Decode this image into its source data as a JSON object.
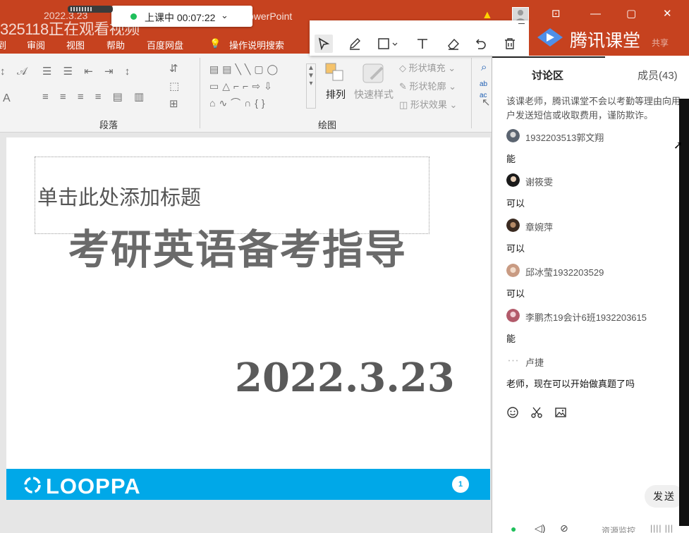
{
  "ppt": {
    "watermark": "325118正在观看视频",
    "date_stamp": "2022.3.23",
    "app_title": "owerPoint",
    "window_controls": [
      "⊡",
      "—",
      "▢",
      "✕"
    ],
    "menu": [
      "到",
      "审阅",
      "视图",
      "帮助",
      "百度网盘",
      "操作说明搜索"
    ],
    "ribbon": {
      "group_paragraph": "段落",
      "group_drawing": "绘图",
      "arrange_label": "排列",
      "quick_styles_label": "快速样式",
      "shape_fill": "形状填充",
      "shape_outline": "形状轮廓",
      "shape_effect": "形状效果",
      "font_a": "A"
    }
  },
  "recording": {
    "status_text": "上课中 00:07:22",
    "status_color": "#1fbf5b"
  },
  "draw_toolbar": {
    "tools": [
      "pointer-icon",
      "pen-icon",
      "rectangle-icon",
      "text-icon",
      "eraser-icon",
      "undo-icon",
      "delete-icon"
    ]
  },
  "slide": {
    "placeholder": "单击此处添加标题",
    "title": "考研英语备考指导",
    "date": "2022.3.23",
    "logo": "LOOPPA",
    "page_number": "1",
    "footer_color": "#00a8e8"
  },
  "tencent": {
    "app_name": "腾讯课堂",
    "share_label": "共享",
    "tabs": {
      "discussion": "讨论区",
      "members": "成员(43)"
    },
    "notice": "该课老师，腾讯课堂不会以考勤等理由向用户发送短信或收取费用，谨防欺诈。",
    "messages": [
      {
        "user": "1932203513郭文翔",
        "text": "能"
      },
      {
        "user": "谢筱雯",
        "text": "可以"
      },
      {
        "user": "章婉萍",
        "text": "可以"
      },
      {
        "user": "邱冰莹1932203529",
        "text": "可以"
      },
      {
        "user": "李鹏杰19会计6班1932203615",
        "text": "能"
      },
      {
        "user": "卢捷",
        "text": "老师，现在可以开始做真题了吗"
      }
    ],
    "compose_icons": [
      "emoji-icon",
      "scissors-icon",
      "image-icon"
    ],
    "send_label": "发送",
    "resource_label": "资源监控",
    "brand_color": "#c6421f"
  }
}
